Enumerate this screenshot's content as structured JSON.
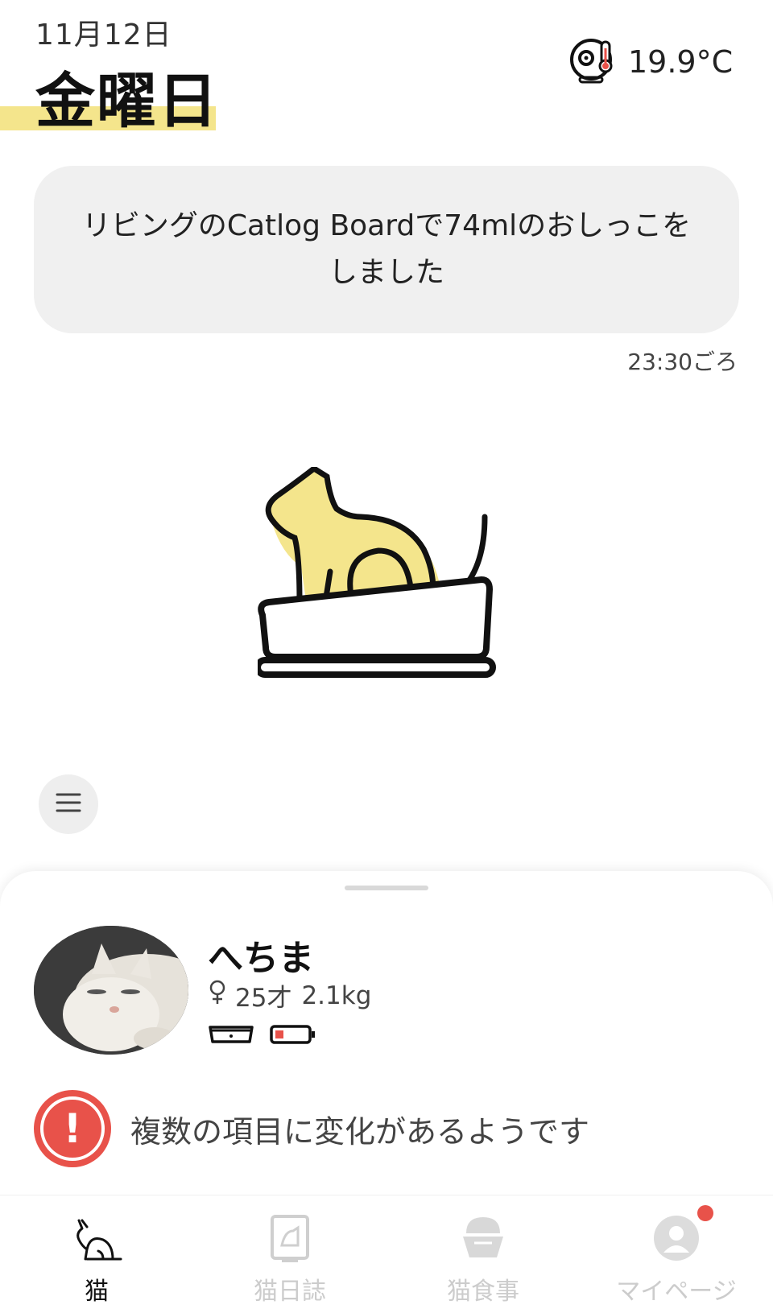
{
  "header": {
    "date": "11月12日",
    "weekday": "金曜日",
    "temperature": "19.9°C",
    "temperature_icon": "device-thermometer-icon"
  },
  "message": {
    "text": "リビングのCatlog Boardで74mlのおしっこをしました",
    "time": "23:30ごろ"
  },
  "illustration": {
    "icon": "cat-in-litter-box-icon",
    "accent": "#f4e58c"
  },
  "menu_button": {
    "icon": "menu-lines-icon"
  },
  "cat": {
    "name": "へちま",
    "gender_icon": "female-icon",
    "age": "25才",
    "weight": "2.1kg",
    "devices": [
      "litter-box-device-icon",
      "collar-battery-low-icon"
    ]
  },
  "alert": {
    "text": "複数の項目に変化があるようです",
    "color": "#e8524a"
  },
  "nav": {
    "items": [
      {
        "label": "猫",
        "icon": "cat-icon",
        "active": true
      },
      {
        "label": "猫日誌",
        "icon": "diary-icon",
        "active": false
      },
      {
        "label": "猫食事",
        "icon": "food-bowl-icon",
        "active": false
      },
      {
        "label": "マイページ",
        "icon": "user-icon",
        "active": false,
        "badge": true
      }
    ]
  }
}
